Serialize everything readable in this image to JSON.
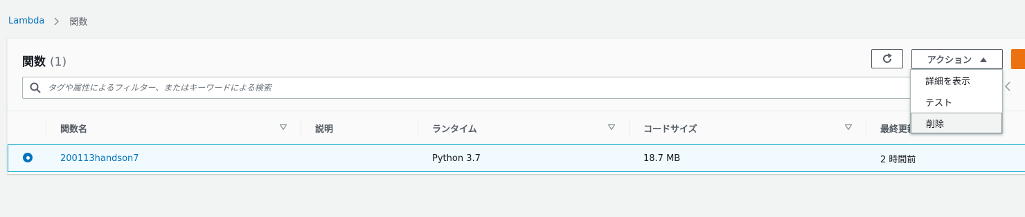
{
  "breadcrumb": {
    "root": "Lambda",
    "current": "関数"
  },
  "panel": {
    "title": "関数",
    "count": "(1)"
  },
  "toolbar": {
    "actions_label": "アクション"
  },
  "search": {
    "placeholder": "タグや属性によるフィルター、またはキーワードによる検索"
  },
  "table": {
    "headers": {
      "name": "関数名",
      "description": "説明",
      "runtime": "ランタイム",
      "code_size": "コードサイズ",
      "last_modified": "最終更新"
    },
    "rows": [
      {
        "selected": true,
        "name": "200113handson7",
        "description": "",
        "runtime": "Python 3.7",
        "code_size": "18.7 MB",
        "last_modified": "2 時間前"
      }
    ]
  },
  "actions_menu": {
    "items": [
      "詳細を表示",
      "テスト",
      "削除"
    ],
    "hovered_index": 2
  },
  "colors": {
    "link": "#0073bb",
    "primary": "#ec7211",
    "selected_row": "#f1faff",
    "selected_border": "#00a1c9"
  }
}
